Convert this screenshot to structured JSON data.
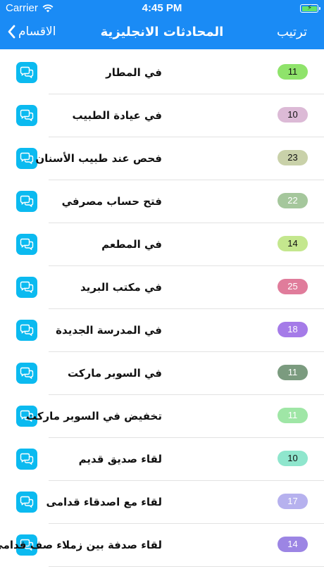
{
  "status_bar": {
    "carrier": "Carrier",
    "time": "4:45 PM"
  },
  "nav": {
    "back_label": "الاقسام",
    "title": "المحادثات الانجليزية",
    "right_label": "ترتيب"
  },
  "items": [
    {
      "title": "في المطار",
      "count": "11",
      "badge_color": "#8fe36b",
      "text_color": "#111111"
    },
    {
      "title": "في عيادة الطبيب",
      "count": "10",
      "badge_color": "#dcbad6",
      "text_color": "#111111"
    },
    {
      "title": "فحص عند طبيب الأسنان",
      "count": "23",
      "badge_color": "#c9d1a9",
      "text_color": "#111111"
    },
    {
      "title": "فتح حساب مصرفي",
      "count": "22",
      "badge_color": "#a5c79c",
      "text_color": "#ffffff"
    },
    {
      "title": "في المطعم",
      "count": "14",
      "badge_color": "#c4e78e",
      "text_color": "#111111"
    },
    {
      "title": "في مكتب البريد",
      "count": "25",
      "badge_color": "#e07c9b",
      "text_color": "#ffffff"
    },
    {
      "title": "في المدرسة الجديدة",
      "count": "18",
      "badge_color": "#a57be8",
      "text_color": "#ffffff"
    },
    {
      "title": "في السوبر ماركت",
      "count": "11",
      "badge_color": "#7b9b7f",
      "text_color": "#ffffff"
    },
    {
      "title": "تخفيض في السوبر ماركت",
      "count": "11",
      "badge_color": "#9fe6a6",
      "text_color": "#ffffff"
    },
    {
      "title": "لقاء صديق قديم",
      "count": "10",
      "badge_color": "#8fe6cd",
      "text_color": "#111111"
    },
    {
      "title": "لقاء مع اصدقاء قدامى",
      "count": "17",
      "badge_color": "#b6b1ee",
      "text_color": "#ffffff"
    },
    {
      "title": "لقاء صدفة بين زملاء صف قدامى",
      "count": "14",
      "badge_color": "#9c85e4",
      "text_color": "#ffffff"
    }
  ]
}
